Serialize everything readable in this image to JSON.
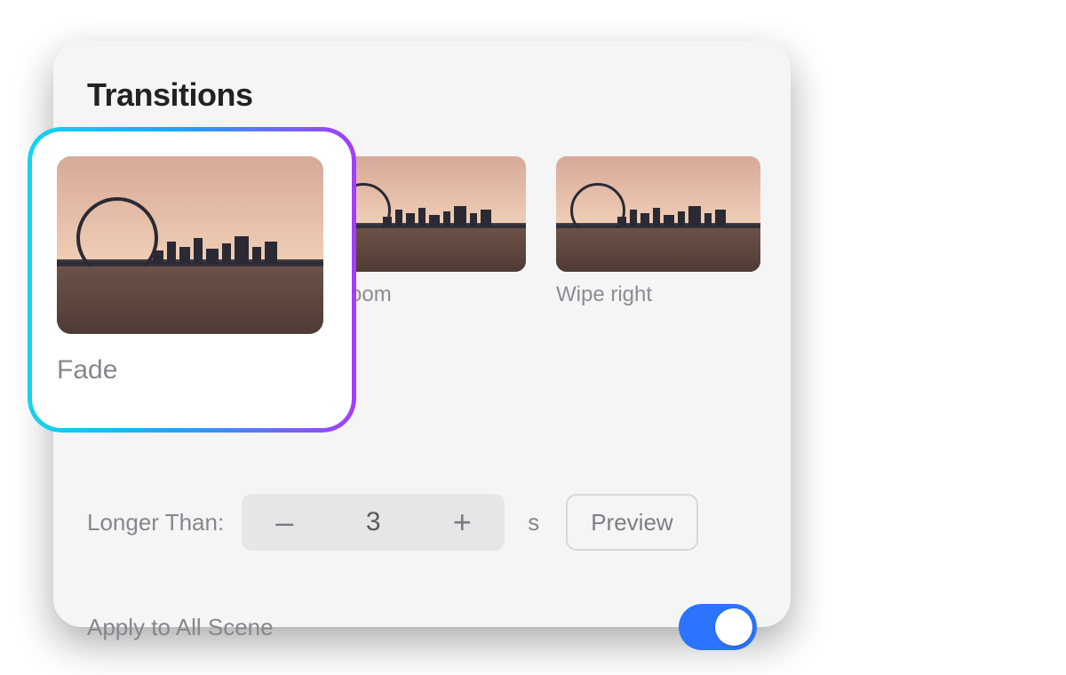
{
  "panel": {
    "title": "Transitions"
  },
  "transitions": [
    {
      "label": "Fade",
      "selected": true
    },
    {
      "label": "Fade zoom",
      "selected": false,
      "visible_label": "e zoom"
    },
    {
      "label": "Wipe right",
      "selected": false
    }
  ],
  "duration": {
    "label": "Longer Than:",
    "value": "3",
    "unit": "s",
    "minus": "–",
    "plus": "+"
  },
  "preview": {
    "label": "Preview"
  },
  "apply_all": {
    "label": "Apply to All Scene",
    "on": true
  },
  "colors": {
    "accent": "#2c73ff",
    "gradient_start": "#14d4ee",
    "gradient_end": "#a63cff"
  }
}
